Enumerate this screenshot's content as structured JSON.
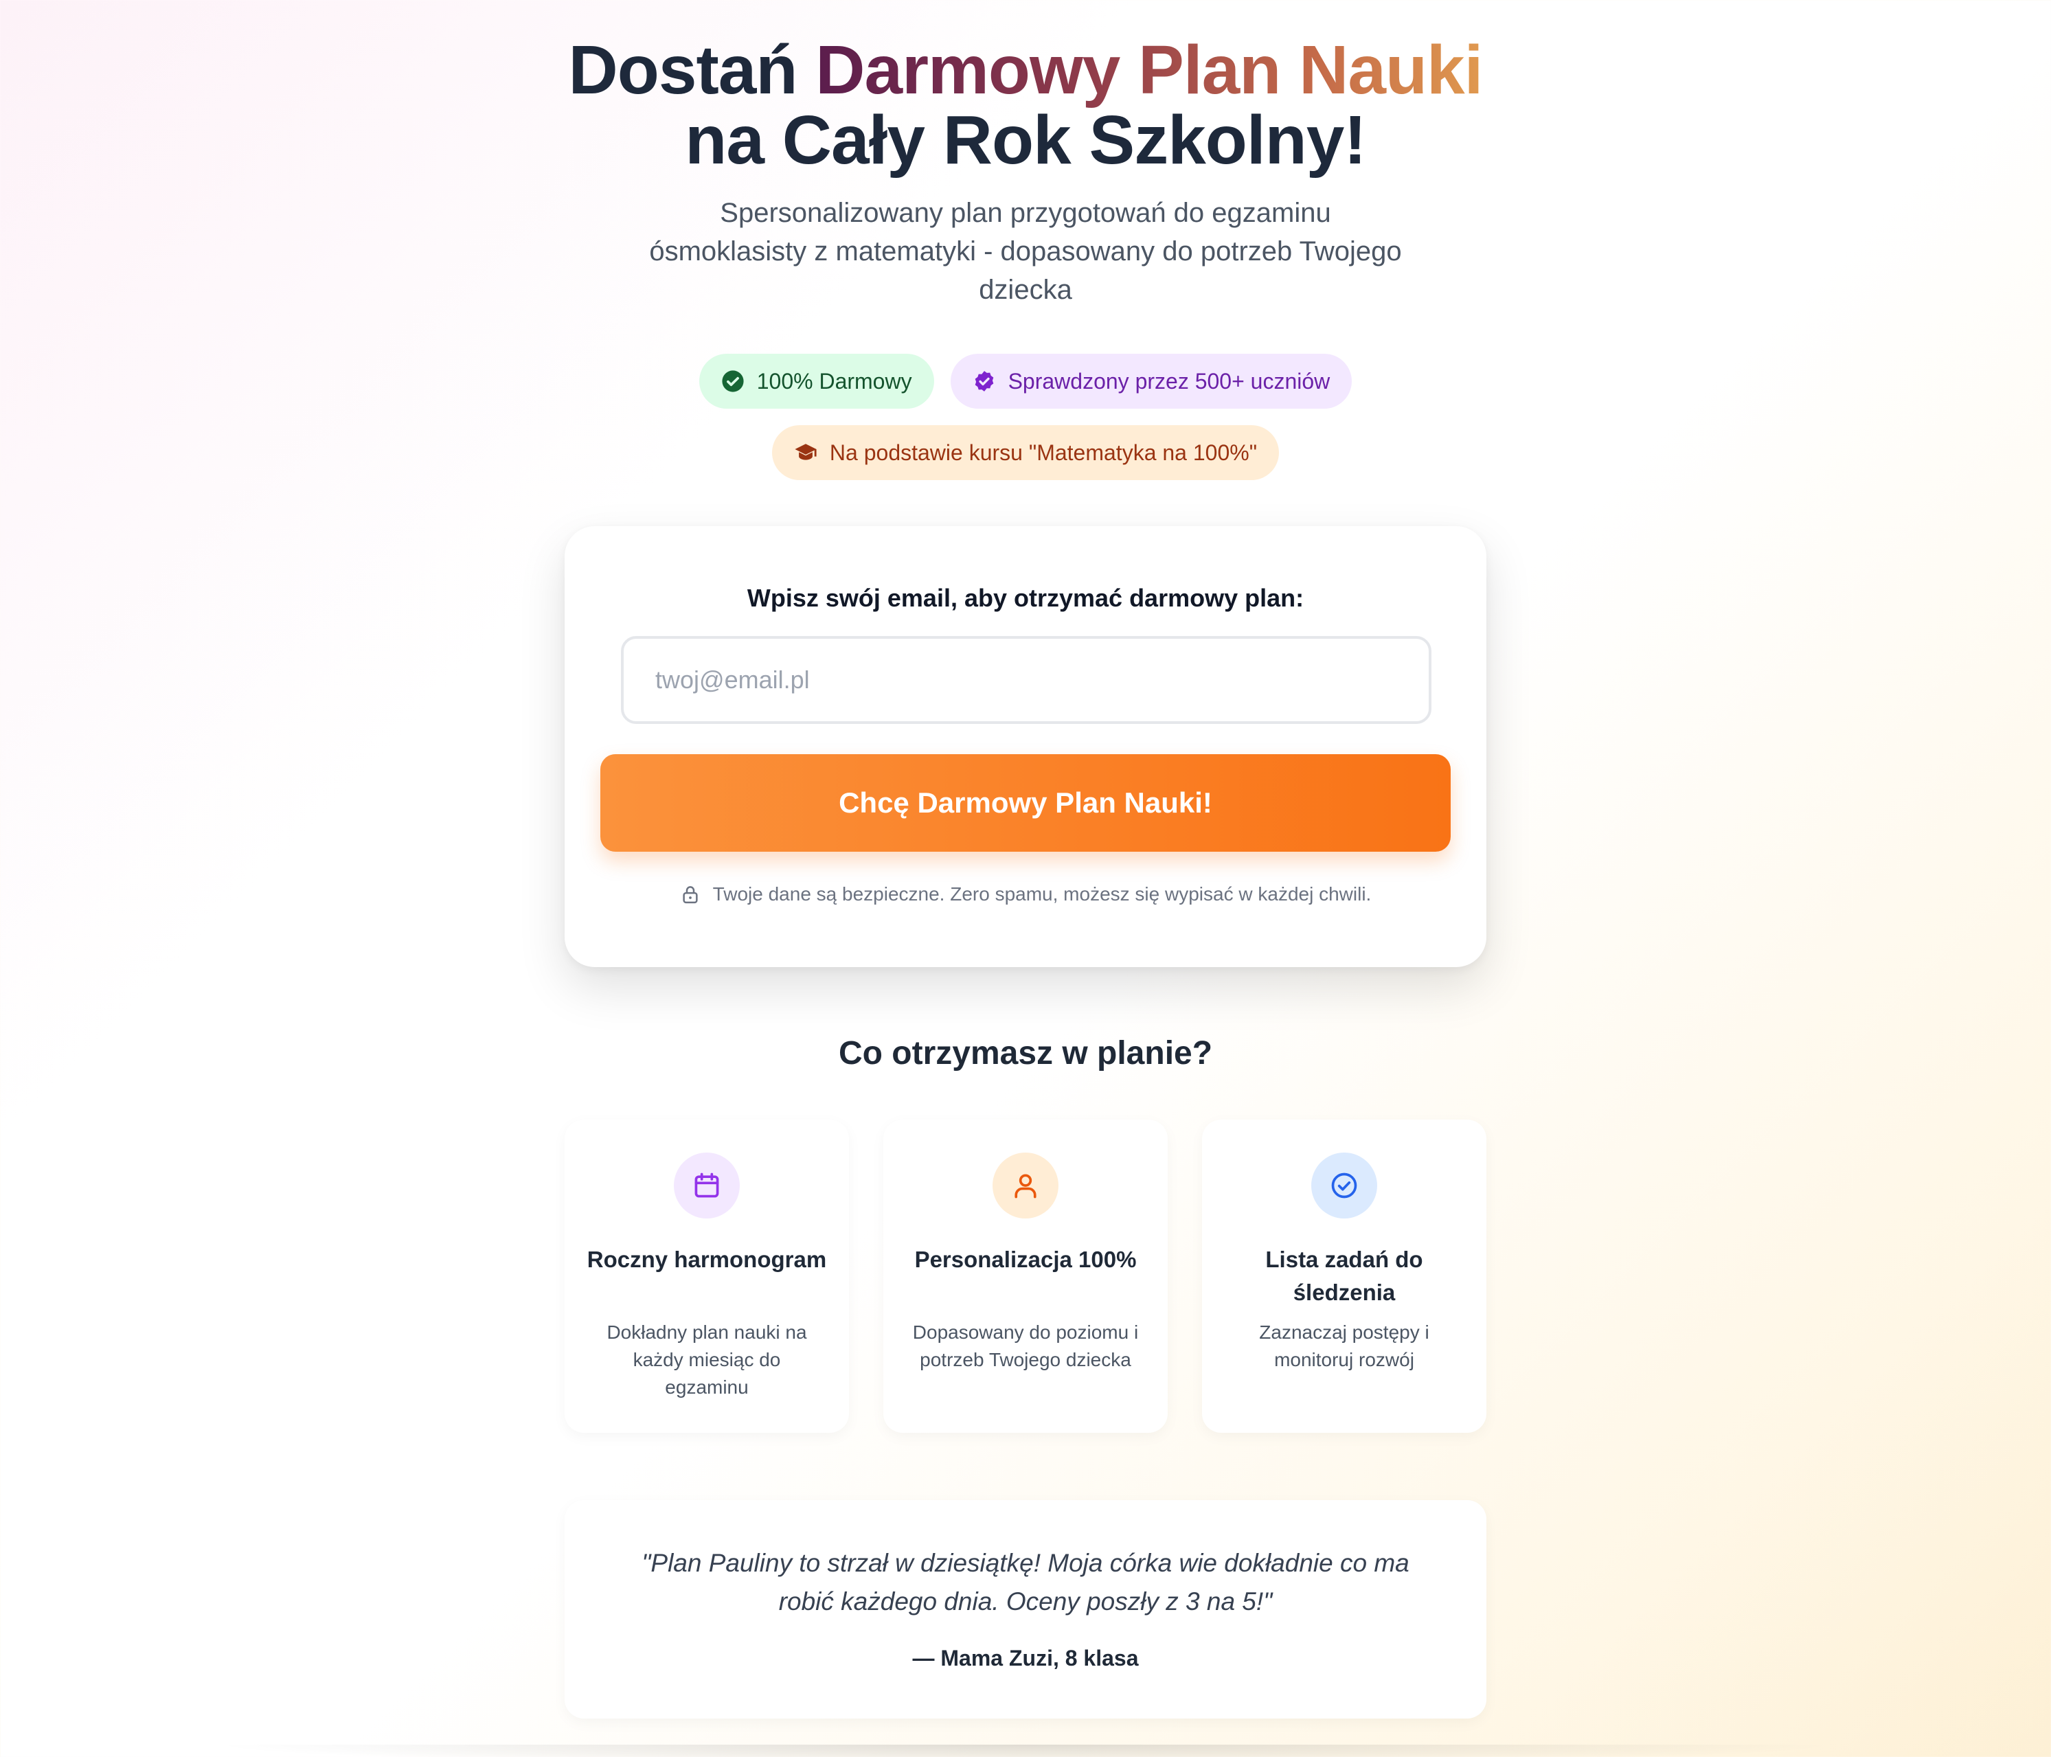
{
  "hero": {
    "title_prefix": "Dostań ",
    "title_highlight": "Darmowy Plan Nauki",
    "title_line2": "na Cały Rok Szkolny!",
    "subtitle": "Spersonalizowany plan przygotowań do egzaminu ósmoklasisty z matematyki - dopasowany do potrzeb Twojego dziecka",
    "gradient_colors": [
      "#5b1d4d",
      "#8e3a4a",
      "#c46a49",
      "#e0994f"
    ]
  },
  "badges": [
    {
      "label": "100% Darmowy",
      "icon": "check-circle-icon",
      "color": "#166534"
    },
    {
      "label": "Sprawdzony przez 500+ uczniów",
      "icon": "verified-badge-icon",
      "color": "#7e22ce"
    },
    {
      "label": "Na podstawie kursu \"Matematyka na 100%\"",
      "icon": "graduation-cap-icon",
      "color": "#9a3412"
    }
  ],
  "form": {
    "label": "Wpisz swój email, aby otrzymać darmowy plan:",
    "email_placeholder": "twoj@email.pl",
    "email_value": "",
    "submit_label": "Chcę Darmowy Plan Nauki!",
    "privacy_note": "Twoje dane są bezpieczne. Zero spamu, możesz się wypisać w każdej chwili.",
    "accent_color": "#f97316"
  },
  "features_section": {
    "title": "Co otrzymasz w planie?",
    "items": [
      {
        "title": "Roczny harmonogram",
        "description": "Dokładny plan nauki na każdy miesiąc do egzaminu",
        "icon": "calendar-icon",
        "icon_color": "#9333ea",
        "icon_bg": "#f3e8ff"
      },
      {
        "title": "Personalizacja 100%",
        "description": "Dopasowany do poziomu i potrzeb Twojego dziecka",
        "icon": "user-icon",
        "icon_color": "#ea580c",
        "icon_bg": "#ffedd5"
      },
      {
        "title": "Lista zadań do śledzenia",
        "description": "Zaznaczaj postępy i monitoruj rozwój",
        "icon": "check-circle-icon",
        "icon_color": "#2563eb",
        "icon_bg": "#dbeafe"
      }
    ]
  },
  "testimonial": {
    "quote": "\"Plan Pauliny to strzał w dziesiątkę! Moja córka wie dokładnie co ma robić każdego dnia. Oceny poszły z 3 na 5!\"",
    "author": "— Mama Zuzi, 8 klasa"
  }
}
